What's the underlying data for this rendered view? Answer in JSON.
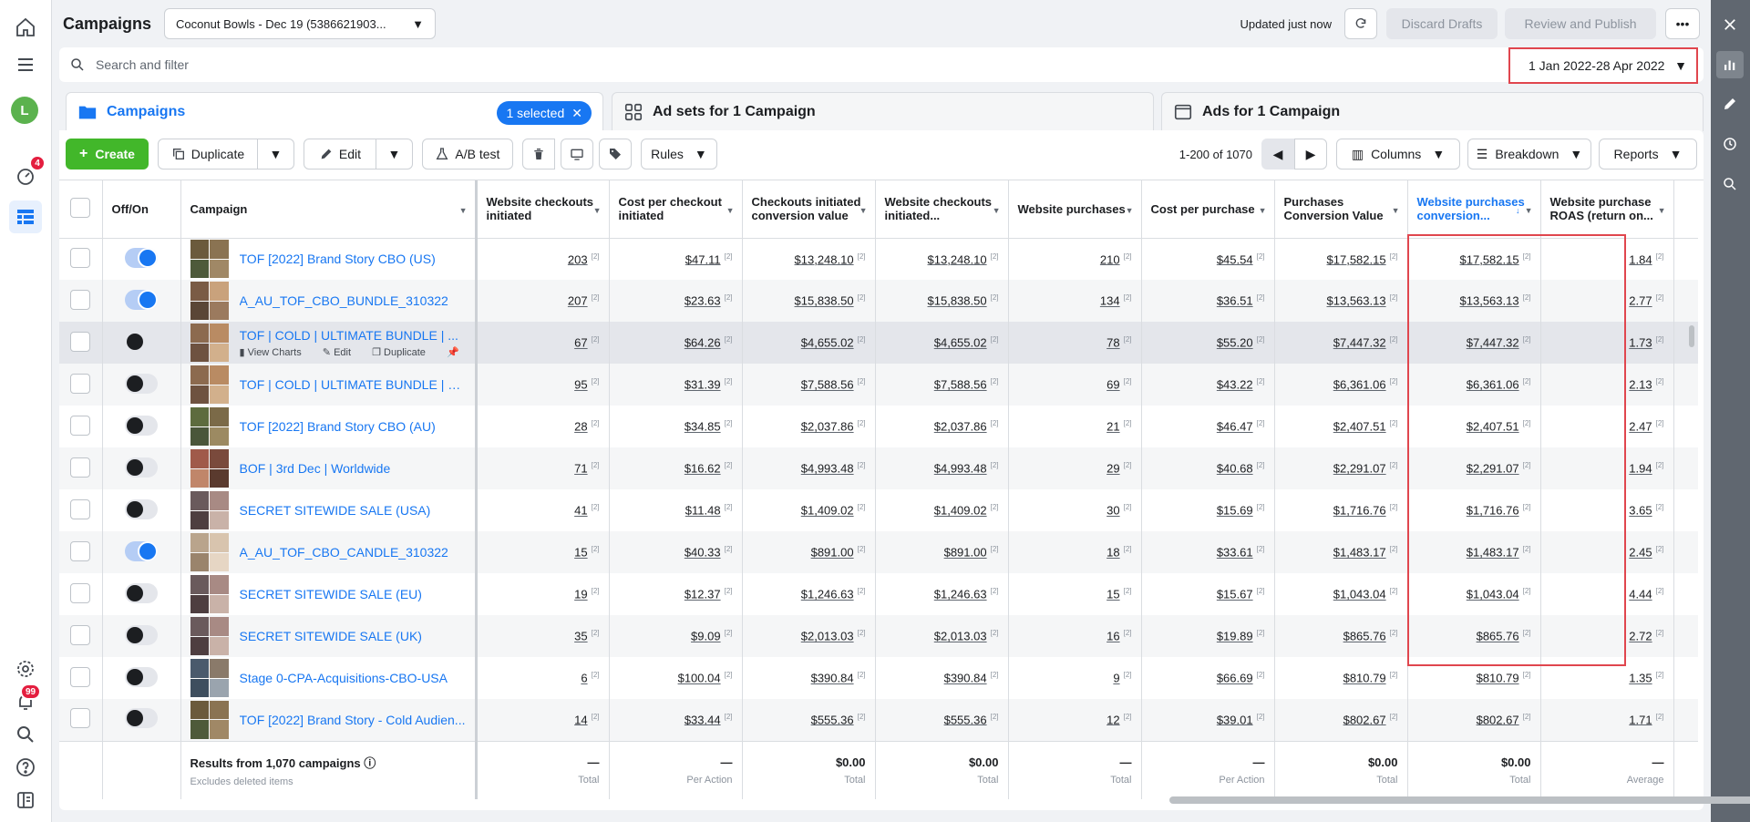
{
  "page": {
    "title": "Campaigns"
  },
  "account": {
    "label": "Coconut Bowls - Dec 19 (5386621903..."
  },
  "header": {
    "updated": "Updated just now",
    "discard": "Discard Drafts",
    "review": "Review and Publish"
  },
  "search": {
    "placeholder": "Search and filter"
  },
  "date_range": "1 Jan 2022-28 Apr 2022",
  "tabs": [
    {
      "label": "Campaigns",
      "pill": "1 selected"
    },
    {
      "label": "Ad sets for 1 Campaign"
    },
    {
      "label": "Ads for 1 Campaign"
    }
  ],
  "toolbar": {
    "create": "Create",
    "duplicate": "Duplicate",
    "edit": "Edit",
    "ab_test": "A/B test",
    "rules": "Rules",
    "pagination": "1-200 of 1070",
    "columns": "Columns",
    "breakdown": "Breakdown",
    "reports": "Reports"
  },
  "rail": {
    "notif_badge": "4",
    "alerts_badge": "99",
    "avatar": "L"
  },
  "columns": [
    "Off/On",
    "Campaign",
    "Website checkouts initiated",
    "Cost per checkout initiated",
    "Checkouts initiated conversion value",
    "Website checkouts initiated...",
    "Website purchases",
    "Cost per purchase",
    "Purchases Conversion Value",
    "Website purchases conversion...",
    "Website purchase ROAS (return on..."
  ],
  "rows": [
    {
      "on": true,
      "name": "TOF [2022] Brand Story CBO (US)",
      "vals": [
        "203",
        "$47.11",
        "$13,248.10",
        "$13,248.10",
        "210",
        "$45.54",
        "$17,582.15",
        "$17,582.15",
        "1.84"
      ]
    },
    {
      "on": true,
      "name": "A_AU_TOF_CBO_BUNDLE_310322",
      "vals": [
        "207",
        "$23.63",
        "$15,838.50",
        "$15,838.50",
        "134",
        "$36.51",
        "$13,563.13",
        "$13,563.13",
        "2.77"
      ]
    },
    {
      "on": false,
      "name": "TOF | COLD | ULTIMATE BUNDLE | ...",
      "vals": [
        "67",
        "$64.26",
        "$4,655.02",
        "$4,655.02",
        "78",
        "$55.20",
        "$7,447.32",
        "$7,447.32",
        "1.73"
      ]
    },
    {
      "on": false,
      "name": "TOF | COLD | ULTIMATE BUNDLE | NE...",
      "vals": [
        "95",
        "$31.39",
        "$7,588.56",
        "$7,588.56",
        "69",
        "$43.22",
        "$6,361.06",
        "$6,361.06",
        "2.13"
      ]
    },
    {
      "on": false,
      "name": "TOF [2022] Brand Story CBO (AU)",
      "vals": [
        "28",
        "$34.85",
        "$2,037.86",
        "$2,037.86",
        "21",
        "$46.47",
        "$2,407.51",
        "$2,407.51",
        "2.47"
      ]
    },
    {
      "on": false,
      "name": "BOF | 3rd Dec | Worldwide",
      "vals": [
        "71",
        "$16.62",
        "$4,993.48",
        "$4,993.48",
        "29",
        "$40.68",
        "$2,291.07",
        "$2,291.07",
        "1.94"
      ]
    },
    {
      "on": false,
      "name": "SECRET SITEWIDE SALE (USA)",
      "vals": [
        "41",
        "$11.48",
        "$1,409.02",
        "$1,409.02",
        "30",
        "$15.69",
        "$1,716.76",
        "$1,716.76",
        "3.65"
      ]
    },
    {
      "on": true,
      "name": "A_AU_TOF_CBO_CANDLE_310322",
      "vals": [
        "15",
        "$40.33",
        "$891.00",
        "$891.00",
        "18",
        "$33.61",
        "$1,483.17",
        "$1,483.17",
        "2.45"
      ]
    },
    {
      "on": false,
      "name": "SECRET SITEWIDE SALE (EU)",
      "vals": [
        "19",
        "$12.37",
        "$1,246.63",
        "$1,246.63",
        "15",
        "$15.67",
        "$1,043.04",
        "$1,043.04",
        "4.44"
      ]
    },
    {
      "on": false,
      "name": "SECRET SITEWIDE SALE (UK)",
      "vals": [
        "35",
        "$9.09",
        "$2,013.03",
        "$2,013.03",
        "16",
        "$19.89",
        "$865.76",
        "$865.76",
        "2.72"
      ]
    },
    {
      "on": false,
      "name": "Stage 0-CPA-Acquisitions-CBO-USA",
      "vals": [
        "6",
        "$100.04",
        "$390.84",
        "$390.84",
        "9",
        "$66.69",
        "$810.79",
        "$810.79",
        "1.35"
      ]
    },
    {
      "on": false,
      "name": "TOF [2022] Brand Story - Cold Audien...",
      "vals": [
        "14",
        "$33.44",
        "$555.36",
        "$555.36",
        "12",
        "$39.01",
        "$802.67",
        "$802.67",
        "1.71"
      ]
    }
  ],
  "hover_actions": {
    "charts": "View Charts",
    "edit": "Edit",
    "duplicate": "Duplicate"
  },
  "footer": {
    "title": "Results from 1,070 campaigns",
    "sub": "Excludes deleted items",
    "cells": [
      {
        "v": "—",
        "s": "Total"
      },
      {
        "v": "—",
        "s": "Per Action"
      },
      {
        "v": "$0.00",
        "s": "Total"
      },
      {
        "v": "$0.00",
        "s": "Total"
      },
      {
        "v": "—",
        "s": "Total"
      },
      {
        "v": "—",
        "s": "Per Action"
      },
      {
        "v": "$0.00",
        "s": "Total"
      },
      {
        "v": "$0.00",
        "s": "Total"
      },
      {
        "v": "—",
        "s": "Average"
      }
    ]
  },
  "colors": {
    "accent": "#1877f2",
    "create": "#42b72a",
    "highlight": "#e0464e"
  }
}
